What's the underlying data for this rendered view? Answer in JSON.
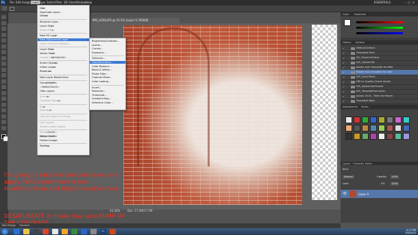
{
  "menubar": {
    "items": [
      "File",
      "Edit",
      "Image",
      "Layer",
      "Type",
      "Select",
      "Filter",
      "3D",
      "View",
      "Window",
      "Help"
    ],
    "active": "Layer",
    "workspace": "ESSENTIALS"
  },
  "layer_menu": {
    "items": [
      {
        "label": "New",
        "arrow": true
      },
      {
        "label": "Duplicate Layer..."
      },
      {
        "label": "Delete",
        "arrow": true
      },
      {
        "sep": true
      },
      {
        "label": "Rename Layer..."
      },
      {
        "label": "Layer Style",
        "arrow": true
      },
      {
        "label": "Smart Filter",
        "arrow": true,
        "disabled": true
      },
      {
        "sep": true
      },
      {
        "label": "New Fill Layer",
        "arrow": true
      },
      {
        "label": "New Adjustment Layer",
        "arrow": true,
        "highlight": true
      },
      {
        "label": "Layer Content Options...",
        "disabled": true
      },
      {
        "sep": true
      },
      {
        "label": "Layer Mask",
        "arrow": true
      },
      {
        "label": "Vector Mask",
        "arrow": true
      },
      {
        "label": "Create Clipping Mask",
        "shortcut": "Alt+Ctrl+G",
        "disabled": true
      },
      {
        "sep": true
      },
      {
        "label": "Smart Objects",
        "arrow": true
      },
      {
        "label": "Video Layers",
        "arrow": true
      },
      {
        "label": "Rasterize",
        "arrow": true
      },
      {
        "sep": true
      },
      {
        "label": "New Layer Based Slice"
      },
      {
        "sep": true
      },
      {
        "label": "Group Layers",
        "shortcut": "Ctrl+G"
      },
      {
        "label": "Ungroup Layers",
        "shortcut": "Shift+Ctrl+G",
        "disabled": true
      },
      {
        "label": "Hide Layers"
      },
      {
        "sep": true
      },
      {
        "label": "Arrange",
        "arrow": true,
        "disabled": true
      },
      {
        "label": "Combine Shapes",
        "arrow": true,
        "disabled": true
      },
      {
        "sep": true
      },
      {
        "label": "Align",
        "arrow": true,
        "disabled": true
      },
      {
        "label": "Distribute",
        "arrow": true,
        "disabled": true
      },
      {
        "sep": true
      },
      {
        "label": "Lock All Layers in Group...",
        "disabled": true
      },
      {
        "sep": true
      },
      {
        "label": "Link Layers",
        "disabled": true
      },
      {
        "label": "Select Linked Layers",
        "disabled": true
      },
      {
        "sep": true
      },
      {
        "label": "Merge Layers",
        "shortcut": "Ctrl+E",
        "disabled": true
      },
      {
        "label": "Merge Visible",
        "shortcut": "Shift+Ctrl+E"
      },
      {
        "label": "Flatten Image"
      },
      {
        "sep": true
      },
      {
        "label": "Matting",
        "arrow": true
      }
    ]
  },
  "adjustment_menu": {
    "items": [
      {
        "label": "Brightness/Contrast..."
      },
      {
        "label": "Levels..."
      },
      {
        "label": "Curves..."
      },
      {
        "label": "Exposure..."
      },
      {
        "sep": true
      },
      {
        "label": "Vibrance..."
      },
      {
        "label": "Hue/Saturation...",
        "highlight": true
      },
      {
        "label": "Color Balance..."
      },
      {
        "label": "Black & White..."
      },
      {
        "label": "Photo Filter..."
      },
      {
        "label": "Channel Mixer..."
      },
      {
        "label": "Color Lookup..."
      },
      {
        "sep": true
      },
      {
        "label": "Invert..."
      },
      {
        "label": "Posterize..."
      },
      {
        "label": "Threshold..."
      },
      {
        "label": "Gradient Map..."
      },
      {
        "label": "Selective Color..."
      }
    ]
  },
  "document": {
    "tab": "IMG_4268.JPG @ 33.3% (Layer 0, RGB/8)",
    "zoom": "33.33%",
    "doc_info": "Doc: 17.2M/17.5M"
  },
  "panels": {
    "color_tabs": [
      "Color",
      "Swatches"
    ],
    "actions_tabs": [
      "History",
      "Actions"
    ],
    "actions": [
      {
        "label": "Default Actions"
      },
      {
        "label": "Tinkerbell Pack"
      },
      {
        "label": "SG_Tinted Kit Pack"
      },
      {
        "label": "IHC_Quickie3D"
      },
      {
        "label": "Brown and Chocolate for Web"
      },
      {
        "label": "Brown and chocolate for web",
        "selected": true
      },
      {
        "label": "IHC_Vinyl Retro"
      },
      {
        "label": "HB Inc Quality Check Action"
      },
      {
        "label": "IHC_AlphaColorTunnel"
      },
      {
        "label": "IHC_TemplateConverter"
      },
      {
        "label": "Action 2013 - Trash the Room"
      },
      {
        "label": "Tinkerbell Bold"
      }
    ],
    "styles_tabs": [
      "Adjustments",
      "Styles"
    ],
    "layers_tabs": [
      "Layers",
      "Channels",
      "Paths"
    ],
    "layer_kind": "Kind",
    "blend_mode": "Normal",
    "opacity_label": "Opacity:",
    "opacity": "100%",
    "fill_label": "Fill:",
    "fill": "100%",
    "lock_label": "Lock:",
    "layer_name": "Layer 0"
  },
  "note": {
    "p1": "I'm going to take the textured layer and apply TWO adjustment layers. Hue/Saturation and Brightness/Contrast.",
    "p2": "DESATUREATE it (make b/w) and BUMP UP THE CONTRAST."
  },
  "bottom": {
    "mini_bridge_tabs": [
      "Mini Bridge",
      "Timeline"
    ]
  },
  "taskbar": {
    "time": "4:17 PM",
    "date": "3/5/2013"
  },
  "colors": {
    "note_red": "#ff2a1a",
    "menu_highlight": "#3a78d4",
    "brick": "#b04a2e"
  }
}
